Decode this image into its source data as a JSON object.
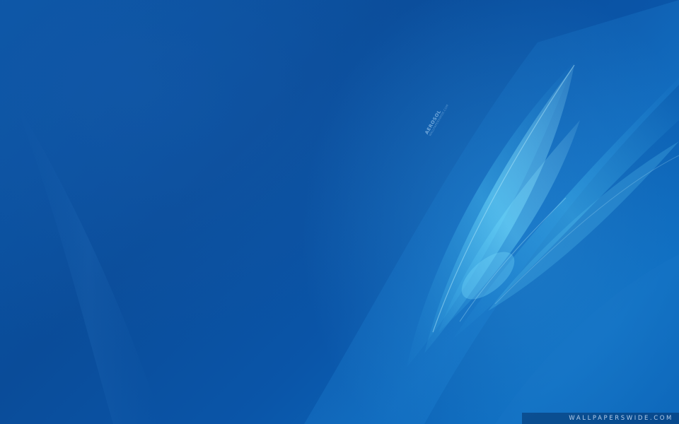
{
  "artwork": {
    "signature_title": "AEROSOL",
    "signature_subtitle": "WALLPAPERSWIDE.COM",
    "watermark": "WALLPAPERSWIDE.COM"
  },
  "colors": {
    "background_dark": "#0a4c99",
    "background_light": "#0d6cc0",
    "highlight": "#5fd0f5"
  }
}
